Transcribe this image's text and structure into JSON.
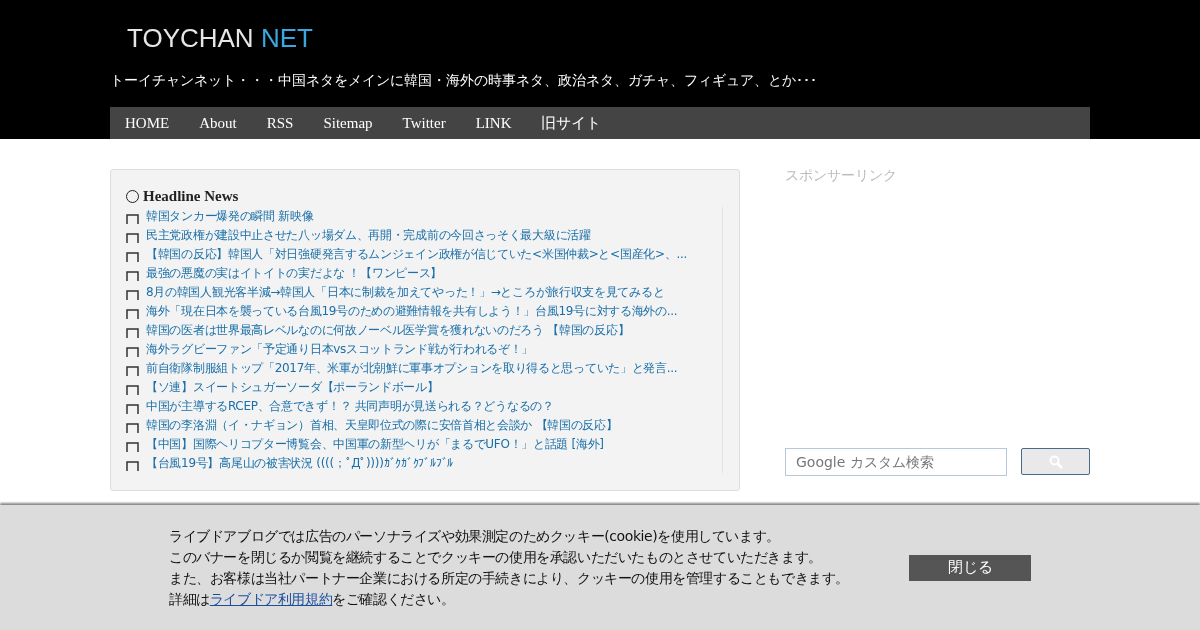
{
  "header": {
    "logo_main": "TOYCHAN",
    "logo_accent": "NET",
    "tagline": "トーイチャンネット・・・中国ネタをメインに韓国・海外の時事ネタ、政治ネタ、ガチャ、フィギュア、とか･･･"
  },
  "nav": [
    "HOME",
    "About",
    "RSS",
    "Sitemap",
    "Twitter",
    "LINK",
    "旧サイト"
  ],
  "headline": {
    "title": "Headline News",
    "items": [
      "韓国タンカー爆発の瞬間 新映像",
      "民主党政権が建設中止させた八ッ場ダム、再開・完成前の今回さっそく最大級に活躍",
      "【韓国の反応】韓国人「対日強硬発言するムンジェイン政権が信じていた<米国仲裁>と<国産化>、...",
      "最強の悪魔の実はイトイトの実だよな ！【ワンピース】",
      "8月の韓国人観光客半減→韓国人「日本に制裁を加えてやった！」→ところが旅行収支を見てみると",
      "海外「現在日本を襲っている台風19号のための避難情報を共有しよう！」台風19号に対する海外の...",
      "韓国の医者は世界最高レベルなのに何故ノーベル医学賞を獲れないのだろう 【韓国の反応】",
      "海外ラグビーファン「予定通り日本vsスコットランド戦が行われるぞ！」",
      "前自衛隊制服組トップ「2017年、米軍が北朝鮮に軍事オプションを取り得ると思っていた」と発言...",
      "【ソ連】スイートシュガーソーダ【ポーランドボール】",
      "中国が主導するRCEP、合意できず！？ 共同声明が見送られる？どうなるの？",
      "韓国の李洛淵（イ・ナギョン）首相、天皇即位式の際に安倍首相と会談か 【韓国の反応】",
      "【中国】国際ヘリコプター博覧会、中国軍の新型ヘリが「まるでUFO！」と話題 [海外]",
      "【台風19号】高尾山の被害状況 ((((；ﾟДﾟ))))ｶﾞｸｶﾞｸﾌﾞﾙﾌﾞﾙ"
    ]
  },
  "sidebar": {
    "sponsor_label": "スポンサーリンク",
    "search": {
      "placeholder": "Google カスタム検索"
    }
  },
  "cookie_banner": {
    "lines": [
      "ライブドアブログでは広告のパーソナライズや効果測定のためクッキー(cookie)を使用しています。",
      "このバナーを閉じるか閲覧を継続することでクッキーの使用を承認いただいたものとさせていただきます。",
      "また、お客様は当社パートナー企業における所定の手続きにより、クッキーの使用を管理することもできます。"
    ],
    "last_line": {
      "prefix": "詳細は",
      "link": "ライブドア利用規約",
      "suffix": "をご確認ください。"
    },
    "close_button": "閉じる"
  }
}
